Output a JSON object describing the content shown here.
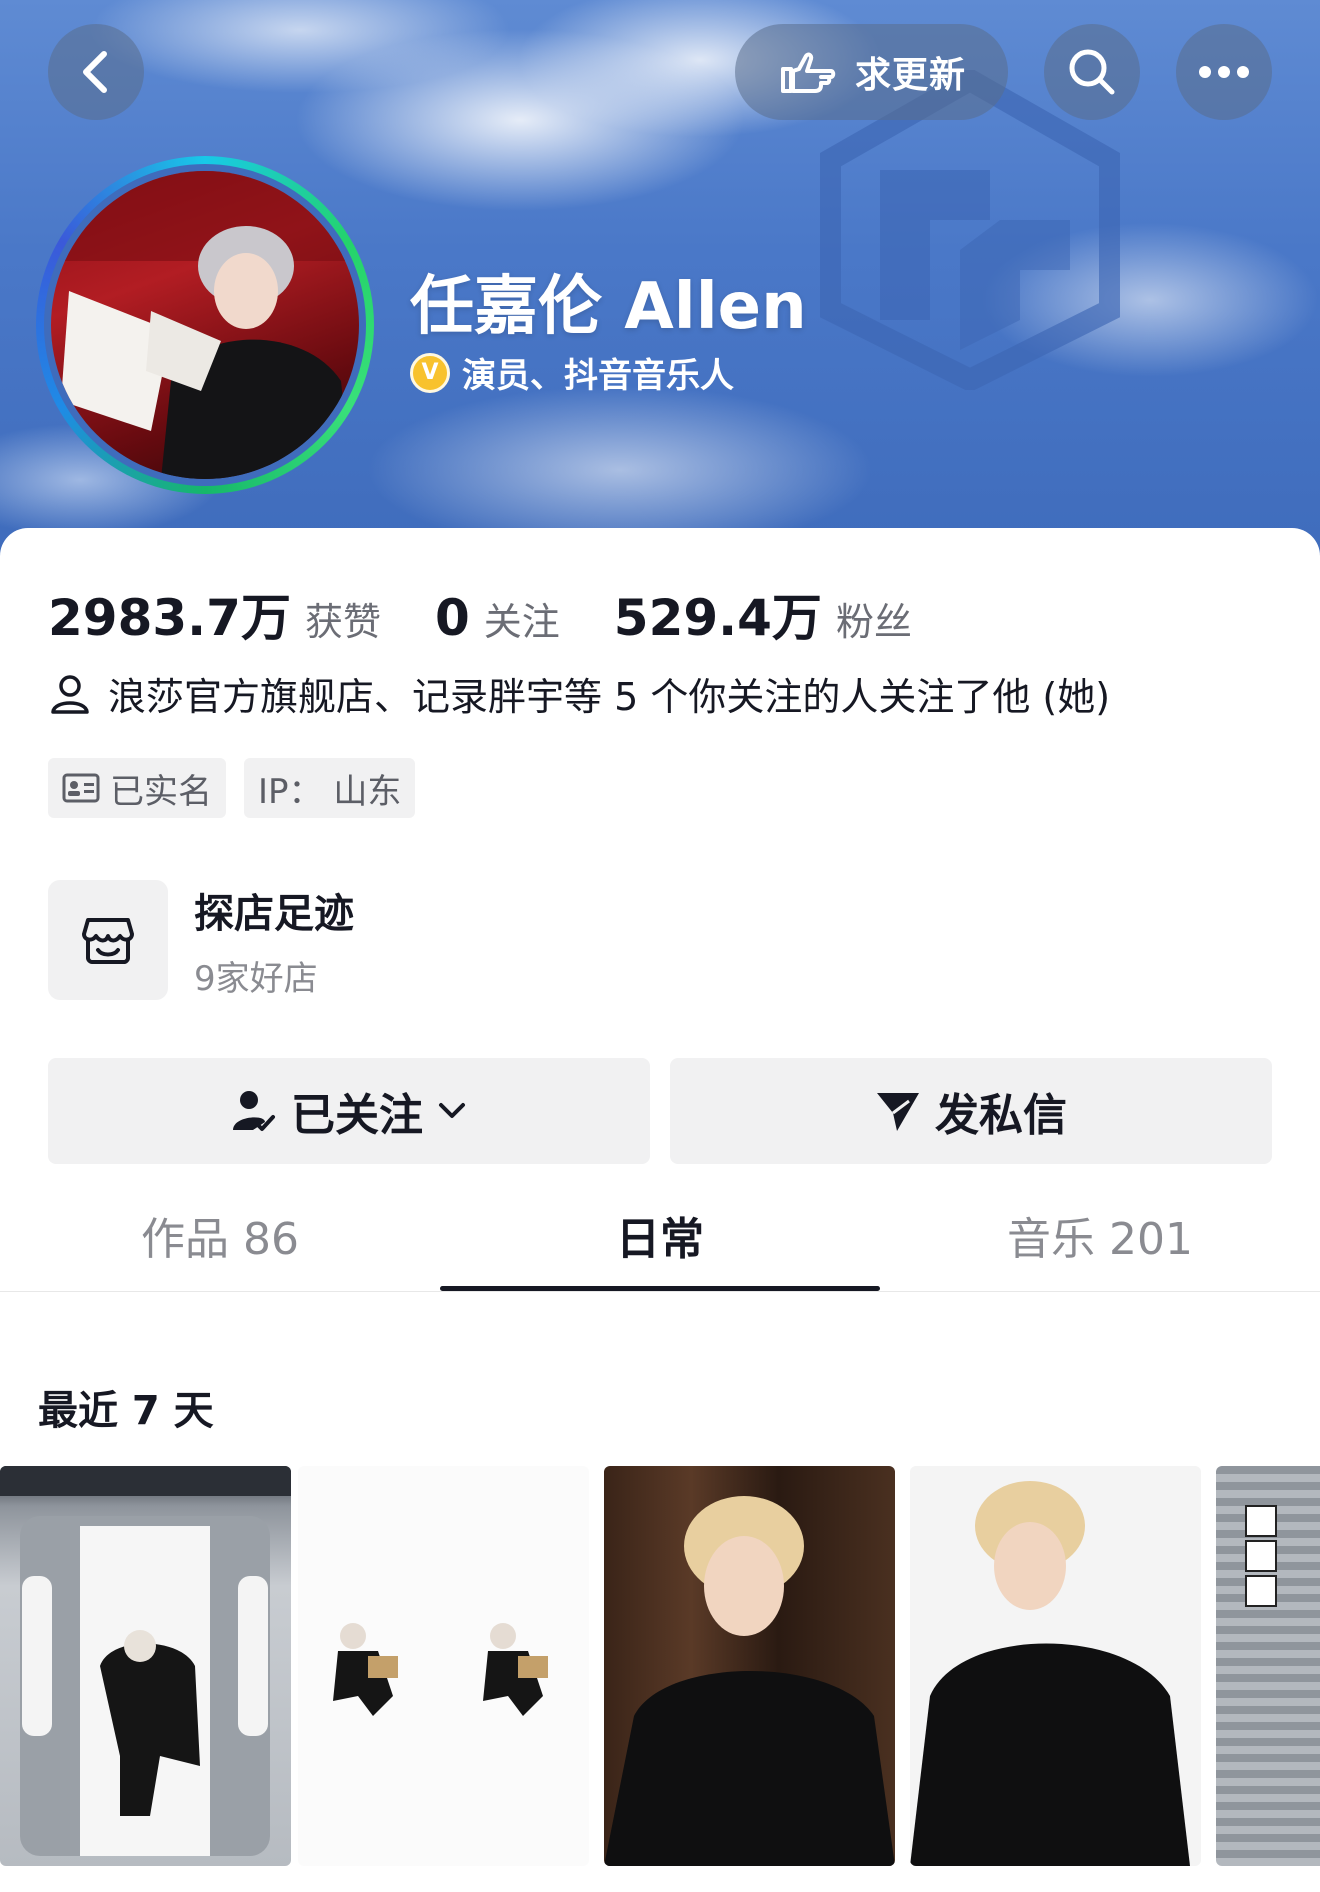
{
  "header": {
    "update_label": "求更新",
    "name": "任嘉伦 Allen",
    "verify_badge": "V",
    "verify_text": "演员、抖音音乐人",
    "icons": [
      "back-icon",
      "hand-point-icon",
      "search-icon",
      "more-icon"
    ]
  },
  "stats": [
    {
      "num": "2983.7万",
      "label": "获赞"
    },
    {
      "num": "0",
      "label": "关注"
    },
    {
      "num": "529.4万",
      "label": "粉丝"
    }
  ],
  "mutual_text": "浪莎官方旗舰店、记录胖宇等 5 个你关注的人关注了他 (她)",
  "tags": {
    "realname": "已实名",
    "ip": "IP： 山东"
  },
  "shop": {
    "title": "探店足迹",
    "subtitle": "9家好店"
  },
  "actions": {
    "follow": "已关注",
    "message": "发私信"
  },
  "tabs": [
    {
      "label": "作品 86"
    },
    {
      "label": "日常"
    },
    {
      "label": "音乐 201"
    }
  ],
  "active_tab": "日常",
  "recent_label": "最近 7 天",
  "colors": {
    "banner": "#4a78c8",
    "verify_badge": "#f8c22d",
    "text_primary": "#161823",
    "text_secondary": "#6b6d75",
    "button_bg": "#f1f1f2"
  }
}
